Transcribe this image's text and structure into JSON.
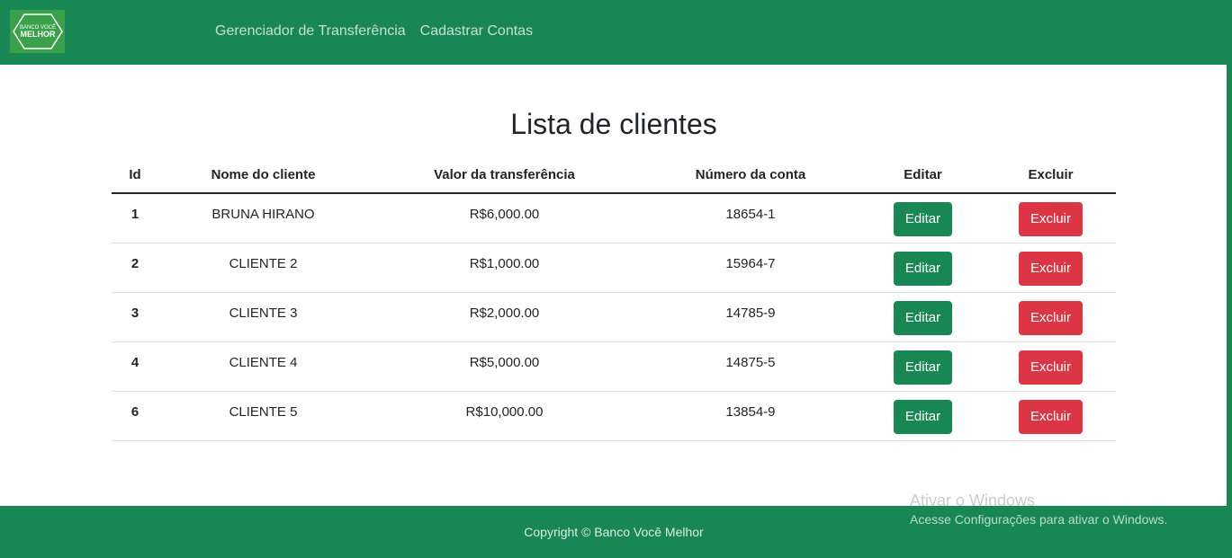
{
  "header": {
    "logo_text_top": "BANCO VOCÊ",
    "logo_text_main": "MELHOR",
    "nav": [
      {
        "label": "Gerenciador de Transferência"
      },
      {
        "label": "Cadastrar Contas"
      }
    ]
  },
  "main": {
    "title": "Lista de clientes",
    "columns": [
      "Id",
      "Nome do cliente",
      "Valor da transferência",
      "Número da conta",
      "Editar",
      "Excluir"
    ],
    "rows": [
      {
        "id": "1",
        "name": "BRUNA HIRANO",
        "value": "R$6,000.00",
        "account": "18654-1",
        "edit": "Editar",
        "delete": "Excluir"
      },
      {
        "id": "2",
        "name": "CLIENTE 2",
        "value": "R$1,000.00",
        "account": "15964-7",
        "edit": "Editar",
        "delete": "Excluir"
      },
      {
        "id": "3",
        "name": "CLIENTE 3",
        "value": "R$2,000.00",
        "account": "14785-9",
        "edit": "Editar",
        "delete": "Excluir"
      },
      {
        "id": "4",
        "name": "CLIENTE 4",
        "value": "R$5,000.00",
        "account": "14875-5",
        "edit": "Editar",
        "delete": "Excluir"
      },
      {
        "id": "6",
        "name": "CLIENTE 5",
        "value": "R$10,000.00",
        "account": "13854-9",
        "edit": "Editar",
        "delete": "Excluir"
      }
    ]
  },
  "footer": {
    "copyright": "Copyright © Banco Você Melhor"
  },
  "watermark": {
    "title": "Ativar o Windows",
    "subtitle": "Acesse Configurações para ativar o Windows."
  },
  "colors": {
    "primary_green": "#198754",
    "danger_red": "#dc3545",
    "logo_green": "#3aa14a"
  }
}
